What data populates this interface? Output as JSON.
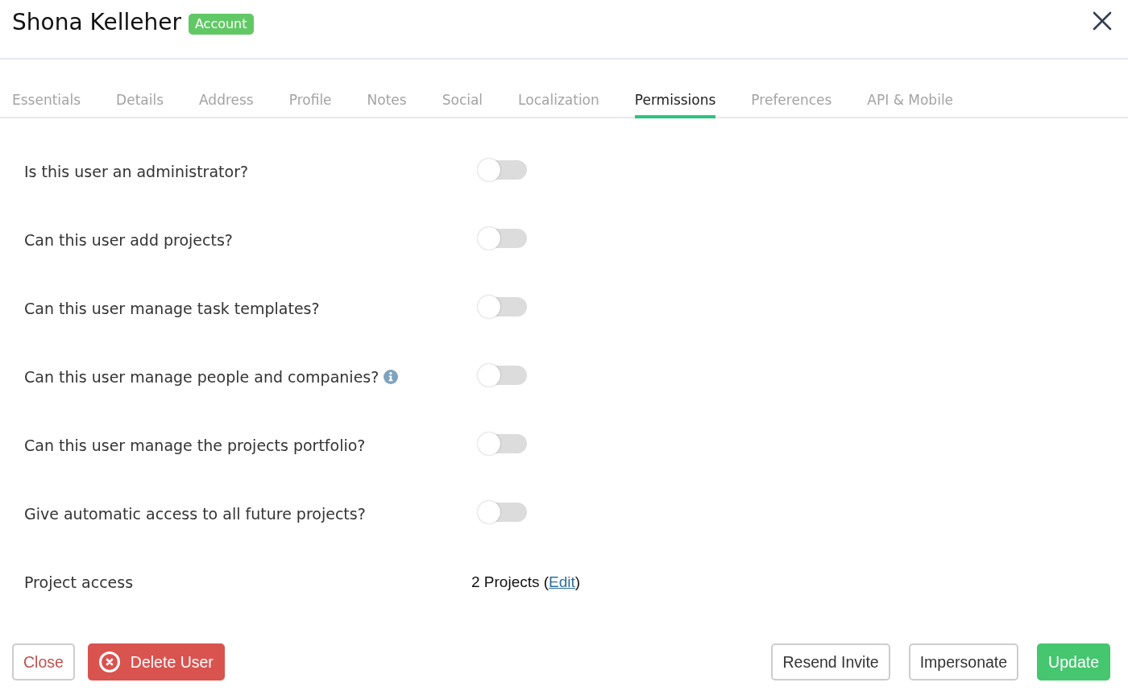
{
  "header": {
    "title": "Shona Kelleher",
    "badge": "Account"
  },
  "tabs": [
    {
      "label": "Essentials",
      "selected": false
    },
    {
      "label": "Details",
      "selected": false
    },
    {
      "label": "Address",
      "selected": false
    },
    {
      "label": "Profile",
      "selected": false
    },
    {
      "label": "Notes",
      "selected": false
    },
    {
      "label": "Social",
      "selected": false
    },
    {
      "label": "Localization",
      "selected": false
    },
    {
      "label": "Permissions",
      "selected": true
    },
    {
      "label": "Preferences",
      "selected": false
    },
    {
      "label": "API & Mobile",
      "selected": false
    }
  ],
  "permissions": [
    {
      "label": "Is this user an administrator?",
      "on": false,
      "info": false
    },
    {
      "label": "Can this user add projects?",
      "on": false,
      "info": false
    },
    {
      "label": "Can this user manage task templates?",
      "on": false,
      "info": false
    },
    {
      "label": "Can this user manage people and companies?",
      "on": false,
      "info": true
    },
    {
      "label": "Can this user manage the projects portfolio?",
      "on": false,
      "info": false
    },
    {
      "label": "Give automatic access to all future projects?",
      "on": false,
      "info": false
    }
  ],
  "project_access": {
    "label": "Project access",
    "value_before": "2 Projects (",
    "link": "Edit",
    "value_after": ")"
  },
  "footer": {
    "left_buttons": [
      {
        "label": "Close",
        "kind": "outline-danger"
      },
      {
        "label": "Delete User",
        "kind": "danger"
      }
    ],
    "right_buttons": [
      {
        "label": "Resend Invite",
        "kind": "outline"
      },
      {
        "label": "Impersonate",
        "kind": "outline"
      },
      {
        "label": "Update",
        "kind": "success"
      }
    ]
  }
}
